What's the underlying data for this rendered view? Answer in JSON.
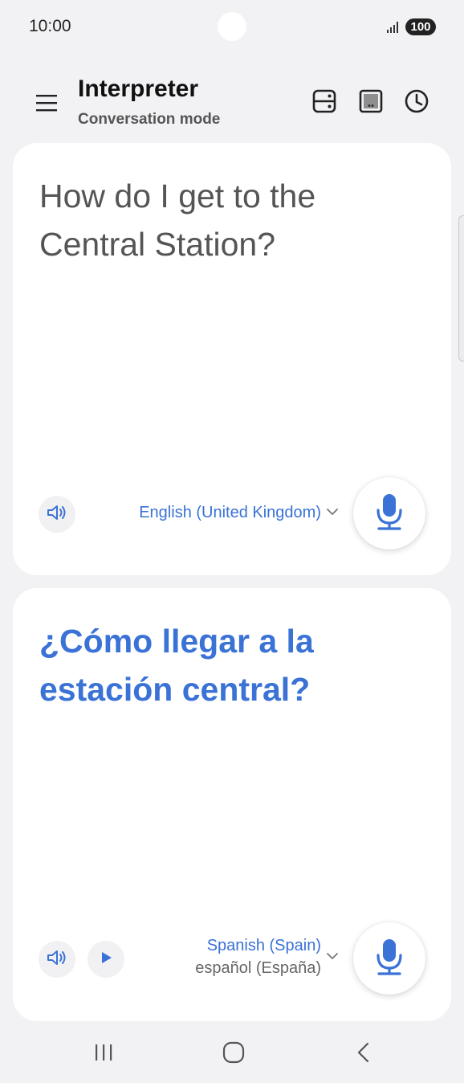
{
  "status_bar": {
    "time": "10:00",
    "battery": "100",
    "icons": [
      "signal-icon",
      "battery-icon"
    ]
  },
  "header": {
    "title": "Interpreter",
    "subtitle": "Conversation mode",
    "icons": [
      "menu-icon",
      "split-view-icon",
      "present-icon",
      "history-icon"
    ]
  },
  "source_panel": {
    "text": "How do I get to the Central Station?",
    "language": "English (United Kingdom)",
    "icons": [
      "speaker-icon",
      "chevron-down-icon",
      "mic-icon"
    ]
  },
  "target_panel": {
    "text": "¿Cómo llegar a la estación central?",
    "language": "Spanish (Spain)",
    "language_native": "español (España)",
    "icons": [
      "speaker-icon",
      "play-icon",
      "chevron-down-icon",
      "mic-icon"
    ]
  },
  "nav_bar": {
    "icons": [
      "recents-icon",
      "home-icon",
      "back-icon"
    ]
  },
  "colors": {
    "accent": "#3a72d6",
    "background": "#f2f2f4",
    "panel": "#ffffff"
  }
}
